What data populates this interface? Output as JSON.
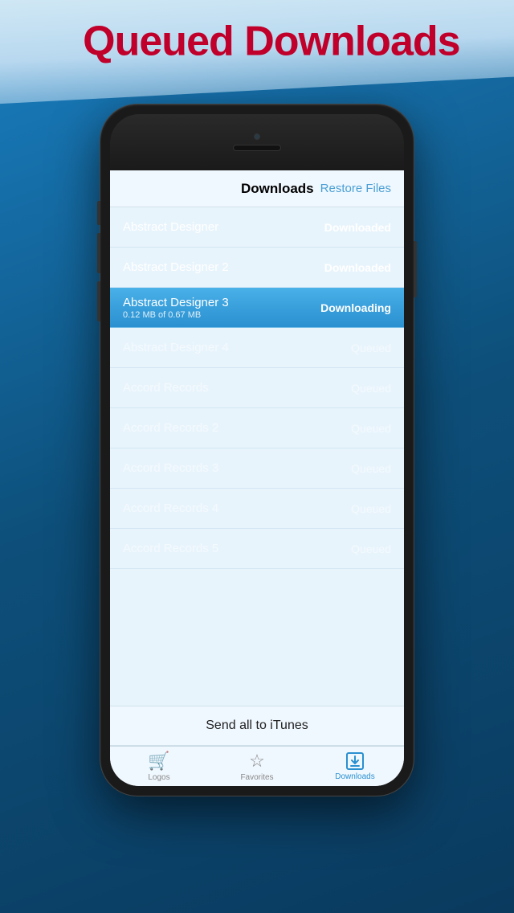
{
  "banner": {
    "text": "Queued Downloads"
  },
  "nav": {
    "title": "Downloads",
    "action": "Restore Files"
  },
  "downloads": [
    {
      "name": "Abstract Designer",
      "status": "Downloaded",
      "type": "done",
      "subtext": ""
    },
    {
      "name": "Abstract Designer 2",
      "status": "Downloaded",
      "type": "done",
      "subtext": ""
    },
    {
      "name": "Abstract Designer 3",
      "status": "Downloading",
      "type": "active",
      "subtext": "0.12 MB of 0.67 MB"
    },
    {
      "name": "Abstract Designer 4",
      "status": "Queued",
      "type": "queued",
      "subtext": ""
    },
    {
      "name": "Accord Records",
      "status": "Queued",
      "type": "queued",
      "subtext": ""
    },
    {
      "name": "Accord Records 2",
      "status": "Queued",
      "type": "queued",
      "subtext": ""
    },
    {
      "name": "Accord Records 3",
      "status": "Queued",
      "type": "queued",
      "subtext": ""
    },
    {
      "name": "Accord Records 4",
      "status": "Queued",
      "type": "queued",
      "subtext": ""
    },
    {
      "name": "Accord Records 5",
      "status": "Queued",
      "type": "queued",
      "subtext": ""
    }
  ],
  "send_all": {
    "label": "Send all to iTunes"
  },
  "tabs": [
    {
      "id": "logos",
      "label": "Logos",
      "icon": "cart",
      "active": false
    },
    {
      "id": "favorites",
      "label": "Favorites",
      "icon": "star",
      "active": false
    },
    {
      "id": "downloads",
      "label": "Downloads",
      "icon": "download",
      "active": true
    }
  ]
}
